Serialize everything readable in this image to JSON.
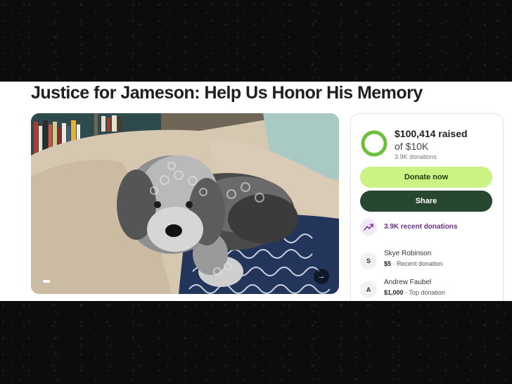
{
  "campaign": {
    "title": "Justice for Jameson: Help Us Honor His Memory"
  },
  "hero": {
    "image": "grey-curly-dog-on-couch",
    "next_icon": "arrow-right-icon"
  },
  "donation": {
    "raised": "$100,414 raised",
    "goal": "of $10K",
    "count": "3.9K donations",
    "progress": 1.0,
    "ring_color": "#6fbf3f",
    "donate_label": "Donate now",
    "share_label": "Share",
    "recent_label": "3.9K recent donations",
    "recent_icon": "trending-up-icon"
  },
  "donors": [
    {
      "initial": "S",
      "name": "Skye Robinson",
      "amount": "$5",
      "tag": "Recent donation"
    },
    {
      "initial": "A",
      "name": "Andrew Faubel",
      "amount": "$1,000",
      "tag": "Top donation"
    }
  ],
  "colors": {
    "accent": "#cbf283",
    "share": "#274730",
    "recent_text": "#6b2f8a"
  }
}
